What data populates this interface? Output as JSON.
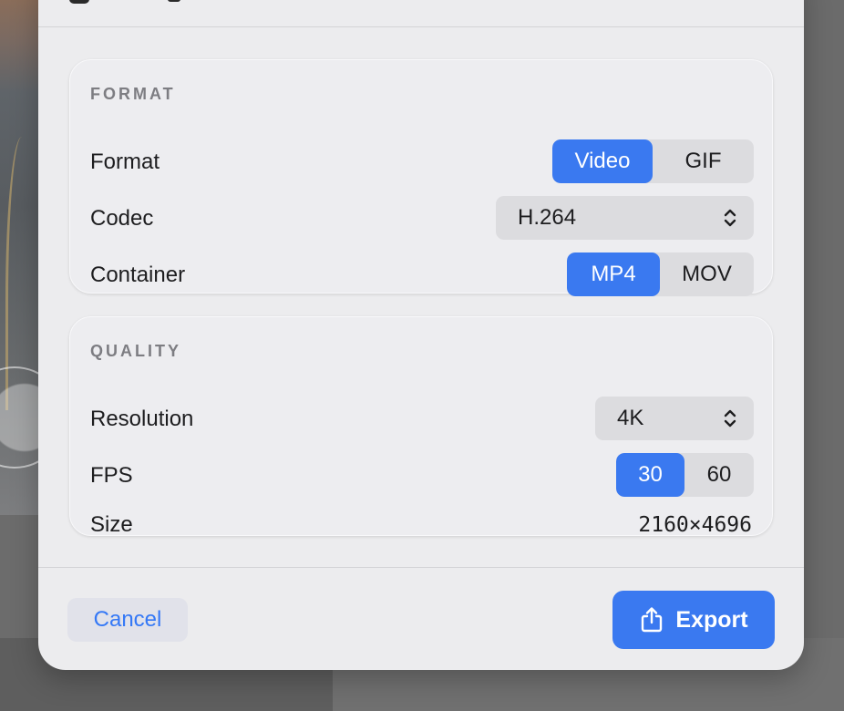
{
  "format_section": {
    "heading": "FORMAT",
    "format": {
      "label": "Format",
      "options": [
        "Video",
        "GIF"
      ],
      "selected": "Video"
    },
    "codec": {
      "label": "Codec",
      "value": "H.264"
    },
    "container": {
      "label": "Container",
      "options": [
        "MP4",
        "MOV"
      ],
      "selected": "MP4"
    }
  },
  "quality_section": {
    "heading": "QUALITY",
    "resolution": {
      "label": "Resolution",
      "value": "4K"
    },
    "fps": {
      "label": "FPS",
      "options": [
        "30",
        "60"
      ],
      "selected": "30"
    },
    "size": {
      "label": "Size",
      "value": "2160×4696"
    }
  },
  "footer": {
    "cancel_label": "Cancel",
    "export_label": "Export"
  },
  "icons": {
    "export": "share-icon",
    "popup": "chevron-up-down-icon"
  },
  "colors": {
    "accent": "#3a79f0",
    "sheet": "#ececee",
    "card": "#ededf0"
  }
}
